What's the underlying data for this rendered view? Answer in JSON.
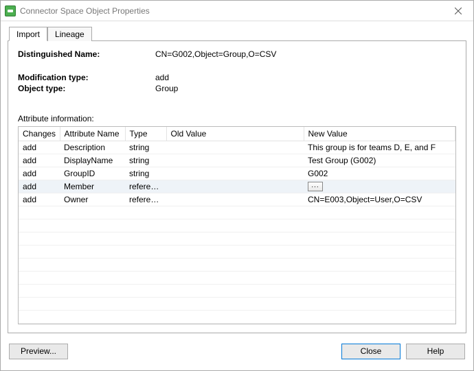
{
  "window": {
    "title": "Connector Space Object Properties"
  },
  "tabs": {
    "import": "Import",
    "lineage": "Lineage"
  },
  "dn": {
    "label": "Distinguished Name:",
    "value": "CN=G002,Object=Group,O=CSV"
  },
  "modification": {
    "label": "Modification type:",
    "value": "add"
  },
  "objecttype": {
    "label": "Object type:",
    "value": "Group"
  },
  "attrinfo_label": "Attribute information:",
  "columns": {
    "changes": "Changes",
    "attribute": "Attribute Name",
    "type": "Type",
    "old": "Old Value",
    "new": "New Value"
  },
  "rows": [
    {
      "changes": "add",
      "attr": "Description",
      "type": "string",
      "old": "",
      "new": "This group is for teams D, E, and F",
      "highlight": false,
      "ellipsis": false
    },
    {
      "changes": "add",
      "attr": "DisplayName",
      "type": "string",
      "old": "",
      "new": "Test Group (G002)",
      "highlight": false,
      "ellipsis": false
    },
    {
      "changes": "add",
      "attr": "GroupID",
      "type": "string",
      "old": "",
      "new": "G002",
      "highlight": false,
      "ellipsis": false
    },
    {
      "changes": "add",
      "attr": "Member",
      "type": "reference",
      "old": "",
      "new": "",
      "highlight": true,
      "ellipsis": true
    },
    {
      "changes": "add",
      "attr": "Owner",
      "type": "reference",
      "old": "",
      "new": "CN=E003,Object=User,O=CSV",
      "highlight": false,
      "ellipsis": false
    }
  ],
  "empty_rows": 9,
  "buttons": {
    "preview": "Preview...",
    "close": "Close",
    "help": "Help"
  }
}
